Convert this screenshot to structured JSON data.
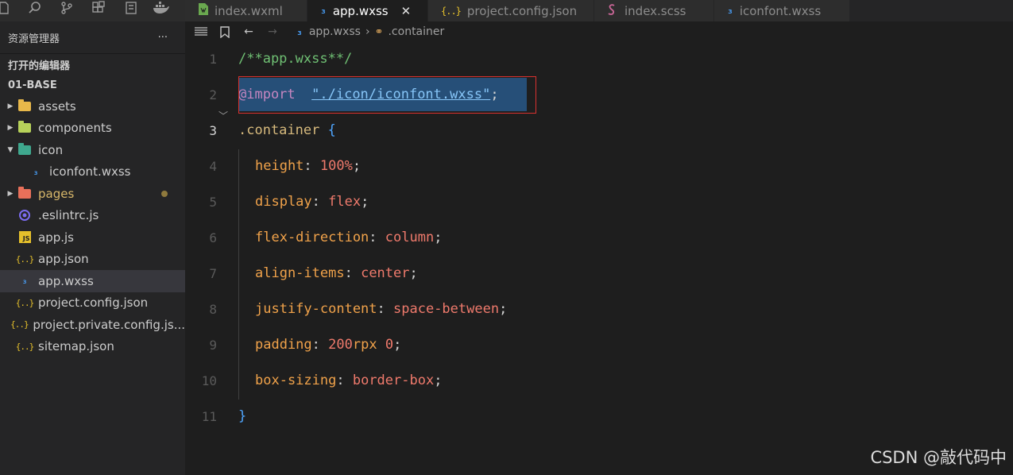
{
  "tabs": [
    {
      "label": "index.wxml",
      "icon": "wxml-file-icon",
      "active": false
    },
    {
      "label": "app.wxss",
      "icon": "wxss-file-icon",
      "active": true
    },
    {
      "label": "project.config.json",
      "icon": "json-file-icon",
      "active": false
    },
    {
      "label": "index.scss",
      "icon": "scss-file-icon",
      "active": false
    },
    {
      "label": "iconfont.wxss",
      "icon": "wxss-file-icon",
      "active": false
    }
  ],
  "sidebar": {
    "title": "资源管理器",
    "more": "···",
    "section": "打开的编辑器",
    "root": "01-BASE",
    "items": [
      {
        "label": "assets"
      },
      {
        "label": "components"
      },
      {
        "label": "icon"
      },
      {
        "label": "iconfont.wxss"
      },
      {
        "label": "pages"
      },
      {
        "label": ".eslintrc.js"
      },
      {
        "label": "app.js"
      },
      {
        "label": "app.json"
      },
      {
        "label": "app.wxss"
      },
      {
        "label": "project.config.json"
      },
      {
        "label": "project.private.config.js..."
      },
      {
        "label": "sitemap.json"
      }
    ]
  },
  "breadcrumb": {
    "file": "app.wxss",
    "symbol": ".container"
  },
  "editor": {
    "line_numbers": [
      "1",
      "2",
      "3",
      "4",
      "5",
      "6",
      "7",
      "8",
      "9",
      "10",
      "11"
    ],
    "code": {
      "l1": "/**app.wxss**/",
      "l2_at": "@import",
      "l2_str": "\"./icon/iconfont.wxss\"",
      "l2_end": ";",
      "l3_sel": ".container",
      "l3_brace": "{",
      "l4_prop": "height",
      "l4_val": "100%",
      "l5_prop": "display",
      "l5_val": "flex",
      "l6_prop": "flex-direction",
      "l6_val": "column",
      "l7_prop": "align-items",
      "l7_val": "center",
      "l8_prop": "justify-content",
      "l8_val": "space-between",
      "l9_prop": "padding",
      "l9_num1": "200",
      "l9_unit": "rpx",
      "l9_num2": "0",
      "l10_prop": "box-sizing",
      "l10_val": "border-box",
      "l11": "}"
    }
  },
  "watermark": "CSDN @敲代码中"
}
